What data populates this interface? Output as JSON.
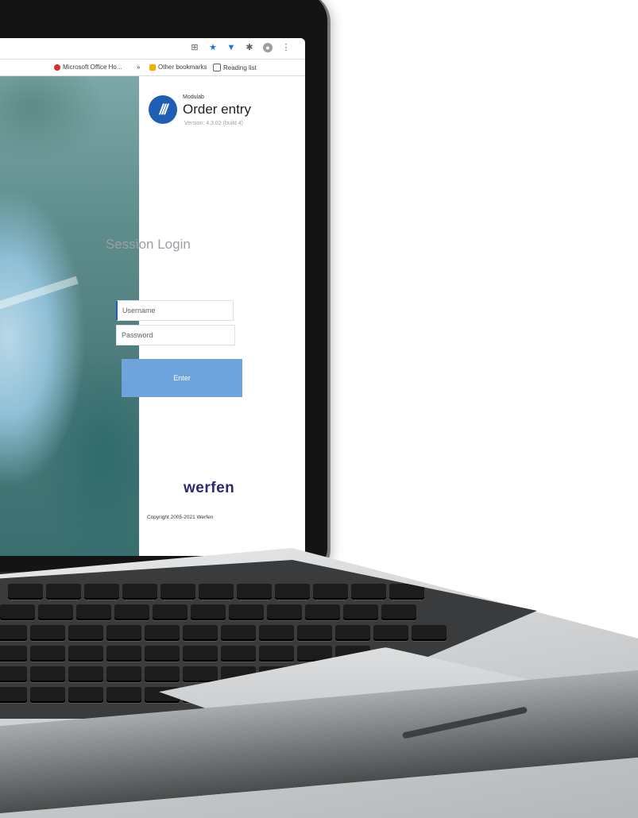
{
  "browser": {
    "toolbar_icons": [
      "extensions-grid-icon",
      "star-icon",
      "pin-icon",
      "puzzle-icon",
      "avatar-icon",
      "more-icon"
    ],
    "bookmarks": [
      {
        "label": "Microsoft Office Ho...",
        "color": "#d93025"
      },
      {
        "label": "»",
        "color": ""
      },
      {
        "label": "Other bookmarks",
        "color": "#f9ab00"
      },
      {
        "label": "Reading list",
        "color": "#5f6368"
      }
    ]
  },
  "app": {
    "logo_text": "///",
    "name": "Modulab",
    "title": "Order entry",
    "version": "Version: 4.3.02 (build 4)",
    "accent": "#1e5fb4"
  },
  "login": {
    "heading": "Session Login",
    "username_placeholder": "Username",
    "password_placeholder": "Password",
    "submit_label": "Enter",
    "button_color": "#6fa3dc"
  },
  "footer": {
    "brand": "werfen",
    "copyright": "Copyright 2005-2021 Werfen"
  }
}
